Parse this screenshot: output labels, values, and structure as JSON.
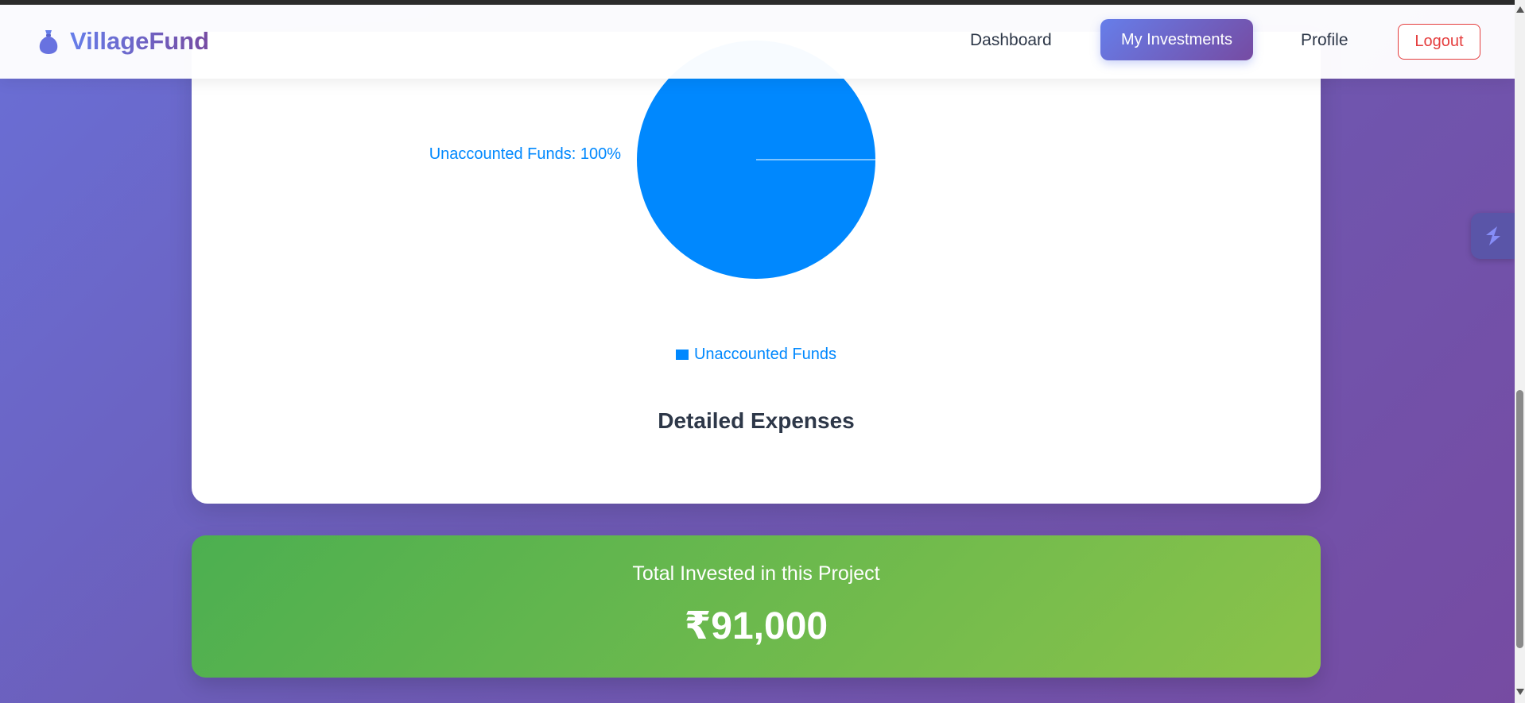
{
  "brand": {
    "name": "VillageFund",
    "icon": "money-bag-icon"
  },
  "nav": {
    "dashboard": "Dashboard",
    "my_investments": "My Investments",
    "profile": "Profile",
    "logout": "Logout"
  },
  "chart_data": {
    "type": "pie",
    "categories": [
      "Unaccounted Funds"
    ],
    "values": [
      100
    ],
    "slice_labels": [
      "Unaccounted Funds: 100%"
    ],
    "legend": [
      "Unaccounted Funds"
    ],
    "legend_position": "bottom",
    "colors": [
      "#0088fe"
    ]
  },
  "expenses": {
    "title": "Detailed Expenses"
  },
  "total": {
    "label": "Total Invested in this Project",
    "amount": "₹91,000"
  },
  "colors": {
    "accent_start": "#667eea",
    "accent_end": "#764ba2",
    "pie": "#0088fe",
    "logout": "#e53e3e",
    "total_start": "#4caf50",
    "total_end": "#8bc34a"
  },
  "floating_button": {
    "icon": "extension-logo-icon"
  }
}
